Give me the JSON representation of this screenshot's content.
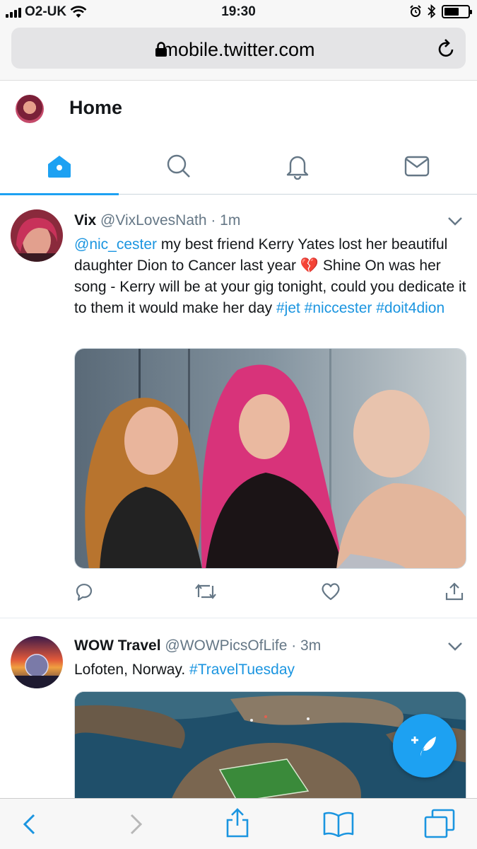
{
  "status_bar": {
    "carrier": "O2-UK",
    "time": "19:30"
  },
  "browser": {
    "url": "mobile.twitter.com"
  },
  "header": {
    "title": "Home"
  },
  "tabs": [
    "home",
    "search",
    "notifications",
    "messages"
  ],
  "accent_color": "#1da1f2",
  "tweets": [
    {
      "name": "Vix",
      "handle": "@VixLovesNath",
      "time": "· 1m",
      "mention": "@nic_cester",
      "text": " my best friend Kerry Yates lost her beautiful daughter Dion to Cancer last year 💔 Shine On was her song - Kerry will be at your gig tonight, could you dedicate it to them it would make her day ",
      "hashtags": "#jet #niccester #doit4dion"
    },
    {
      "name": "WOW Travel",
      "handle": "@WOWPicsOfLife",
      "time": "· 3m",
      "text": "Lofoten, Norway. ",
      "hashtags": "#TravelTuesday"
    }
  ]
}
